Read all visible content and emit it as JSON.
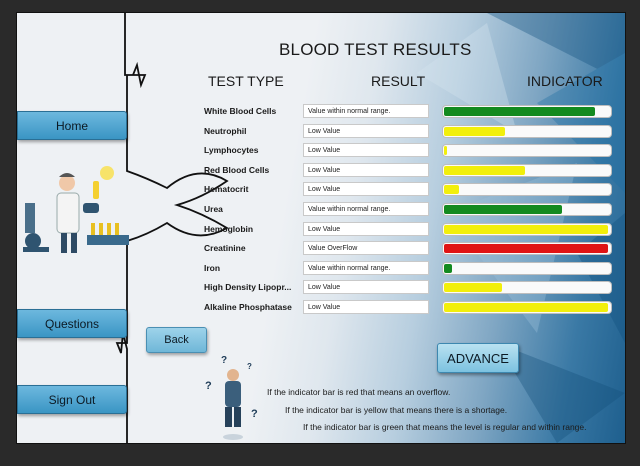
{
  "title": "BLOOD TEST RESULTS",
  "columns": {
    "test_type": "TEST TYPE",
    "result": "RESULT",
    "indicator": "INDICATOR"
  },
  "nav": {
    "home": "Home",
    "questions": "Questions",
    "sign_out": "Sign Out"
  },
  "buttons": {
    "back": "Back",
    "advance": "ADVANCE"
  },
  "colors": {
    "green": "#138a1f",
    "yellow": "#f2ef0b",
    "red": "#e01414"
  },
  "tests": [
    {
      "name": "White Blood Cells",
      "result": "Value within normal range.",
      "level": 0.91,
      "status": "green"
    },
    {
      "name": "Neutrophil",
      "result": "Low Value",
      "level": 0.37,
      "status": "yellow"
    },
    {
      "name": "Lymphocytes",
      "result": "Low Value",
      "level": 0.02,
      "status": "yellow"
    },
    {
      "name": "Red Blood Cells",
      "result": "Low Value",
      "level": 0.49,
      "status": "yellow"
    },
    {
      "name": "Hematocrit",
      "result": "Low Value",
      "level": 0.09,
      "status": "yellow"
    },
    {
      "name": "Urea",
      "result": "Value within normal range.",
      "level": 0.71,
      "status": "green"
    },
    {
      "name": "Hemoglobin",
      "result": "Low Value",
      "level": 0.99,
      "status": "yellow"
    },
    {
      "name": "Creatinine",
      "result": "Value OverFlow",
      "level": 0.99,
      "status": "red"
    },
    {
      "name": "Iron",
      "result": "Value within normal range.",
      "level": 0.05,
      "status": "green"
    },
    {
      "name": "High Density Lipopr...",
      "result": "Low Value",
      "level": 0.35,
      "status": "yellow"
    },
    {
      "name": "Alkaline Phosphatase",
      "result": "Low Value",
      "level": 0.99,
      "status": "yellow"
    }
  ],
  "notes": [
    "If the indicator bar is red that means an overflow.",
    "If the indicator bar is yellow that means there is a shortage.",
    "If the indicator bar is green that means the level is regular and within range."
  ]
}
